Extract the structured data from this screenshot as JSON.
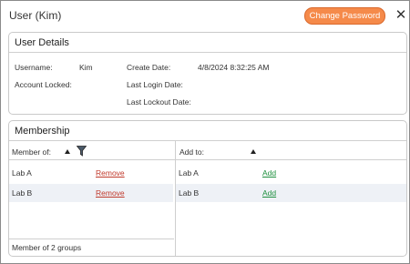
{
  "window": {
    "title": "User (Kim)",
    "change_password_label": "Change Password",
    "close_glyph": "✕"
  },
  "details": {
    "title": "User Details",
    "username_label": "Username:",
    "username_value": "Kim",
    "account_locked_label": "Account Locked:",
    "create_date_label": "Create Date:",
    "create_date_value": "4/8/2024 8:32:25 AM",
    "last_login_label": "Last Login Date:",
    "last_lockout_label": "Last Lockout Date:"
  },
  "membership": {
    "title": "Membership",
    "member_of": {
      "header": "Member of:",
      "items": [
        {
          "name": "Lab A",
          "action": "Remove"
        },
        {
          "name": "Lab B",
          "action": "Remove"
        }
      ],
      "footer": "Member of 2 groups"
    },
    "add_to": {
      "header": "Add to:",
      "items": [
        {
          "name": "Lab A",
          "action": "Add"
        },
        {
          "name": "Lab B",
          "action": "Add"
        }
      ]
    }
  },
  "colors": {
    "accent": "#f58a4a",
    "remove_link": "#c0392b",
    "add_link": "#1e8f3e",
    "alt_row": "#eef1f6"
  },
  "icons": {
    "sort": "sort-ascending-icon",
    "filter": "filter-icon",
    "close": "close-icon"
  }
}
